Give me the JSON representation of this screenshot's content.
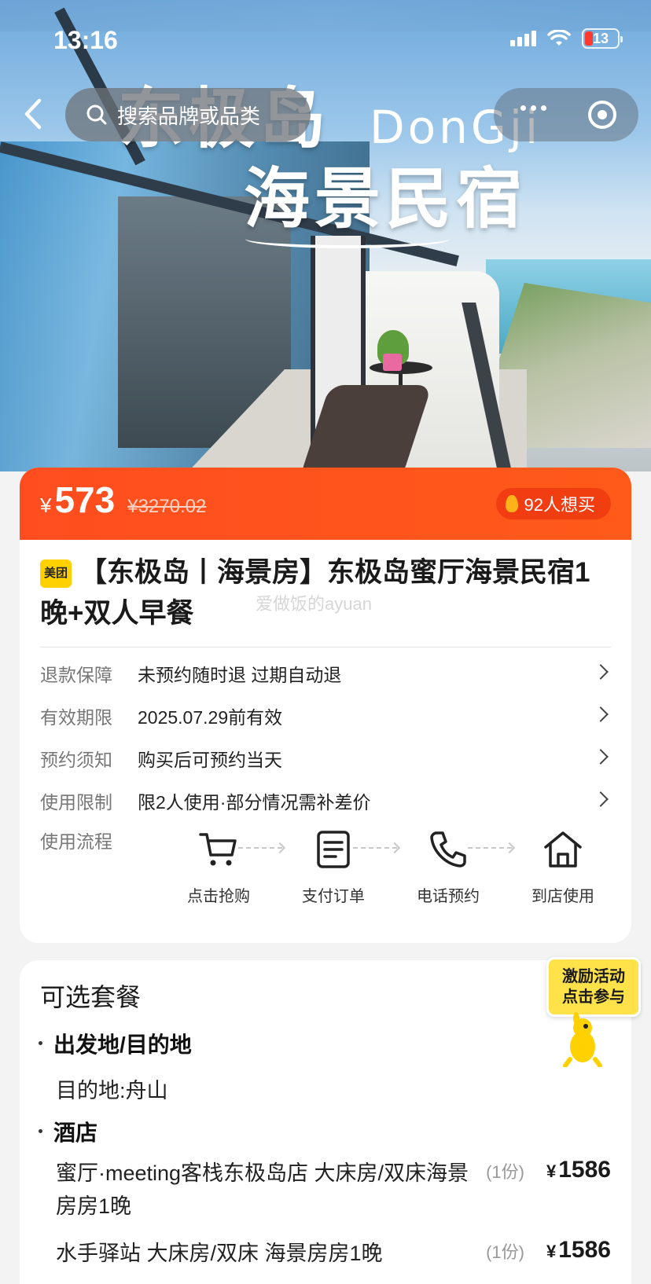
{
  "status_bar": {
    "time": "13:16",
    "battery": "13"
  },
  "hero": {
    "title_line1": "东极岛",
    "title_line2": "海景民宿",
    "title_en": "DonGji"
  },
  "nav": {
    "search_placeholder": "搜索品牌或品类"
  },
  "price": {
    "currency": "¥",
    "current": "573",
    "original": "¥3270.02",
    "wants": "92人想买"
  },
  "product": {
    "brand_badge": "美团",
    "title": "【东极岛丨海景房】东极岛蜜厅海景民宿1晚+双人早餐",
    "watermark": "爱做饭的ayuan"
  },
  "info": [
    {
      "key": "退款保障",
      "value": "未预约随时退 过期自动退"
    },
    {
      "key": "有效期限",
      "value": "2025.07.29前有效"
    },
    {
      "key": "预约须知",
      "value": "购买后可预约当天"
    },
    {
      "key": "使用限制",
      "value": "限2人使用·部分情况需补差价"
    }
  ],
  "flow": {
    "key": "使用流程",
    "steps": [
      {
        "label": "点击抢购",
        "icon": "cart-icon"
      },
      {
        "label": "支付订单",
        "icon": "document-icon"
      },
      {
        "label": "电话预约",
        "icon": "phone-icon"
      },
      {
        "label": "到店使用",
        "icon": "home-icon"
      }
    ]
  },
  "packages": {
    "title": "可选套餐",
    "sections": [
      {
        "heading": "出发地/目的地",
        "text": "目的地:舟山"
      },
      {
        "heading": "酒店"
      }
    ],
    "items": [
      {
        "name": "蜜厅·meeting客栈东极岛店 大床房/双床海景房房1晚",
        "qty": "(1份)",
        "currency": "¥",
        "price": "1586"
      },
      {
        "name": "水手驿站 大床房/双床 海景房房1晚",
        "qty": "(1份)",
        "currency": "¥",
        "price": "1586"
      }
    ]
  },
  "promo": {
    "line1": "激励活动",
    "line2": "点击参与"
  },
  "colors": {
    "accent": "#ff4d1f",
    "badge": "#ffd100",
    "promo": "#ffe14a"
  }
}
